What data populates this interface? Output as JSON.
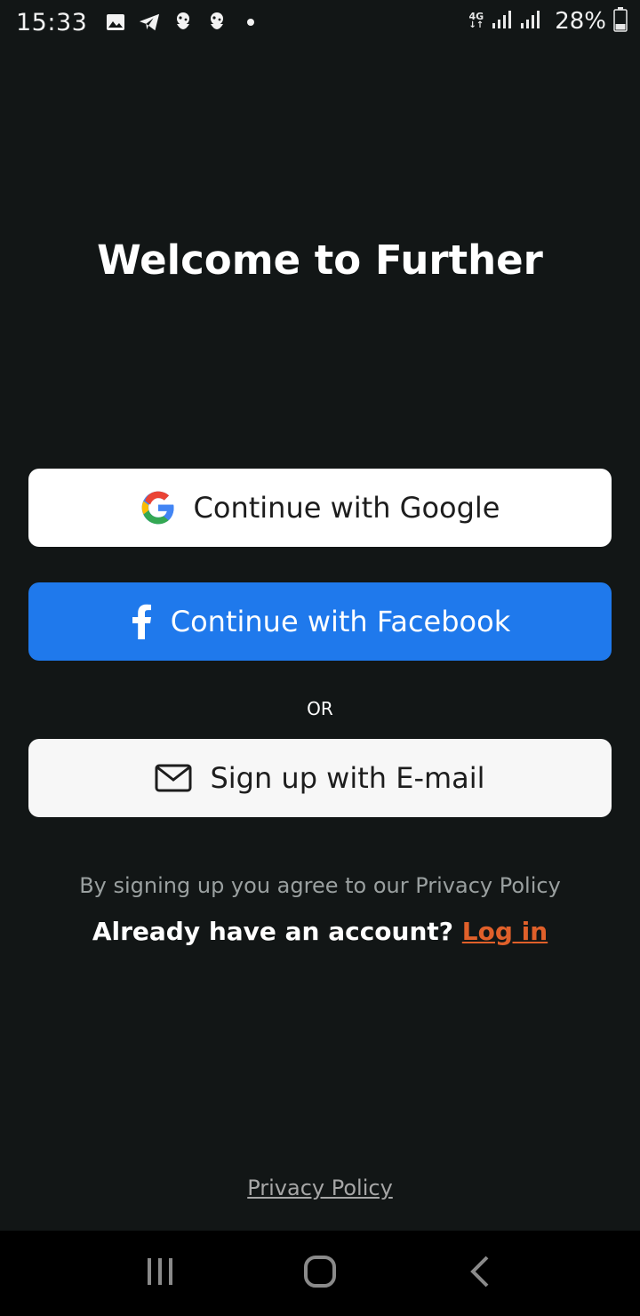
{
  "status_bar": {
    "time": "15:33",
    "network_type": "4G",
    "battery_percent": "28%",
    "icons_left": [
      "gallery-icon",
      "telegram-icon",
      "premier-league-icon",
      "premier-league-icon",
      "dot-icon"
    ],
    "icons_right": [
      "signal-icon",
      "signal-icon",
      "battery-icon"
    ]
  },
  "welcome": {
    "title": "Welcome to Further"
  },
  "auth": {
    "google_label": "Continue with Google",
    "facebook_label": "Continue with Facebook",
    "or_label": "OR",
    "email_label": "Sign up with E-mail",
    "agree_text": "By signing up you agree to our Privacy Policy",
    "have_account_text": "Already have an account?",
    "login_label": "Log in",
    "privacy_policy_label": "Privacy Policy"
  },
  "colors": {
    "background": "#121616",
    "facebook_blue": "#1f79ec",
    "login_accent": "#e0602a"
  },
  "nav_bar": {
    "items": [
      "recents-icon",
      "home-icon",
      "back-icon"
    ]
  }
}
